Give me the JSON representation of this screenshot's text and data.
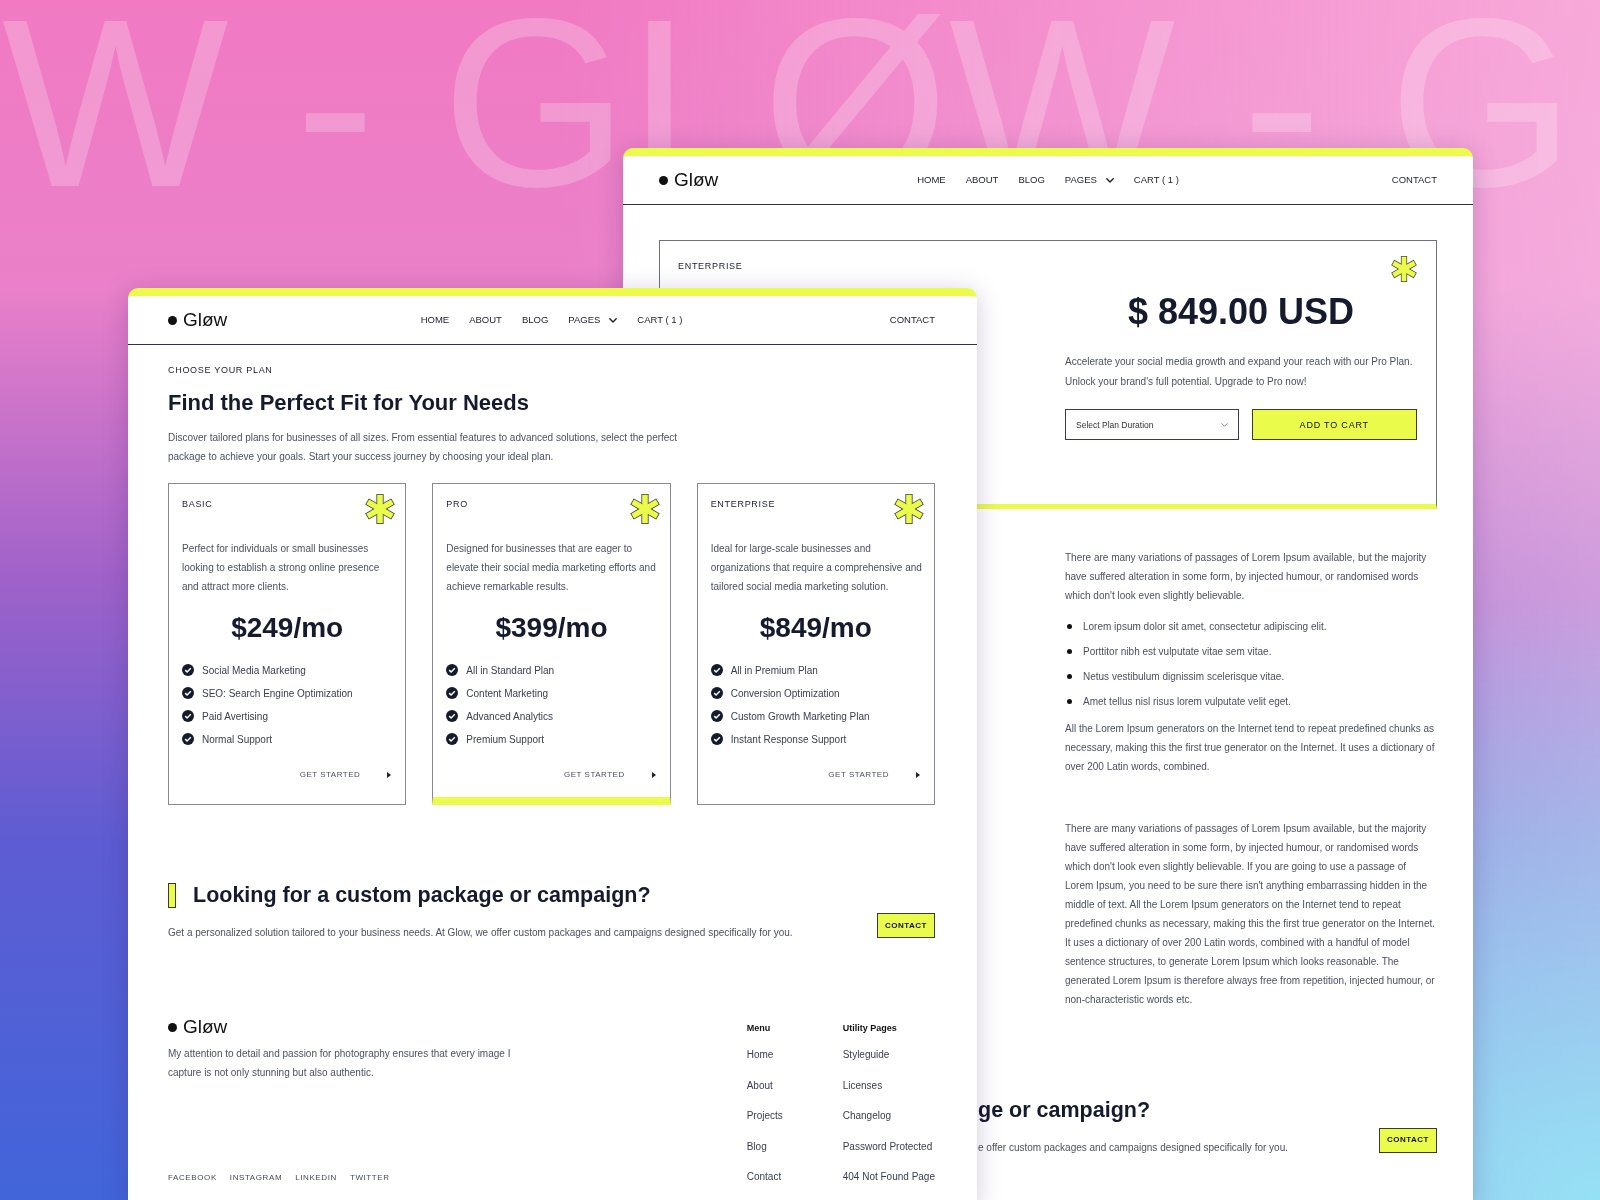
{
  "background": {
    "lettering": "W - GLØW - G"
  },
  "back_window": {
    "header": {
      "logo": "Gløw",
      "nav": [
        {
          "label": "HOME",
          "kind": "link"
        },
        {
          "label": "ABOUT",
          "kind": "link"
        },
        {
          "label": "BLOG",
          "kind": "link"
        },
        {
          "label": "PAGES",
          "kind": "dropdown"
        },
        {
          "label": "CART ( 1 )",
          "kind": "link"
        }
      ],
      "contact": "CONTACT"
    },
    "product": {
      "tier": "ENTERPRISE",
      "price": "$ 849.00 USD",
      "description": "Accelerate your social media growth and expand your reach with our Pro Plan. Unlock your brand's full potential. Upgrade to Pro now!",
      "duration_select": {
        "placeholder": "Select Plan Duration"
      },
      "add_to_cart": "ADD TO CART"
    },
    "article": [
      {
        "kind": "paragraph",
        "text": "There are many variations of passages of Lorem Ipsum available, but the majority have suffered alteration in some form, by injected humour, or randomised words which don't look even slightly believable."
      },
      {
        "kind": "list",
        "items": [
          "Lorem ipsum dolor sit amet, consectetur adipiscing elit.",
          "Porttitor nibh est vulputate vitae sem vitae.",
          "Netus vestibulum dignissim scelerisque vitae.",
          "Amet tellus nisl risus lorem vulputate velit eget."
        ]
      },
      {
        "kind": "paragraph",
        "text": "All the Lorem Ipsum generators on the Internet tend to repeat predefined chunks as necessary, making this the first true generator on the Internet. It uses a dictionary of over 200 Latin words, combined."
      },
      {
        "kind": "paragraph",
        "text": "There are many variations of passages of Lorem Ipsum available, but the majority have suffered alteration in some form, by injected humour, or randomised words which don't look even slightly believable. If you are going to use a passage of Lorem Ipsum, you need to be sure there isn't anything embarrassing hidden in the middle of text. All the Lorem Ipsum generators on the Internet tend to repeat predefined chunks as necessary, making this the first true generator on the Internet. It uses a dictionary of over 200 Latin words, combined with a handful of model sentence structures, to generate Lorem Ipsum which looks reasonable. The generated Lorem Ipsum is therefore always free from repetition, injected humour, or non-characteristic words etc."
      }
    ],
    "cta": {
      "heading": "ge or campaign?",
      "text": "e offer custom packages and campaigns designed specifically for you.",
      "button": "CONTACT"
    }
  },
  "front_window": {
    "header": {
      "logo": "Gløw",
      "nav": [
        {
          "label": "HOME",
          "kind": "link"
        },
        {
          "label": "ABOUT",
          "kind": "link"
        },
        {
          "label": "BLOG",
          "kind": "link"
        },
        {
          "label": "PAGES",
          "kind": "dropdown"
        },
        {
          "label": "CART ( 1 )",
          "kind": "link"
        }
      ],
      "contact": "CONTACT"
    },
    "plans": {
      "eyebrow": "CHOOSE YOUR PLAN",
      "heading": "Find the Perfect Fit for Your Needs",
      "intro": "Discover tailored plans for businesses of all sizes. From essential features to advanced solutions, select the perfect package to achieve your goals. Start your success journey by choosing your ideal plan.",
      "cards": [
        {
          "name": "BASIC",
          "description": "Perfect for individuals or small businesses looking to establish a strong online presence and attract more clients.",
          "price": "$249/mo",
          "features": [
            "Social Media Marketing",
            "SEO: Search Engine Optimization",
            "Paid Avertising",
            "Normal Support"
          ],
          "cta": "GET STARTED",
          "selected": false
        },
        {
          "name": "PRO",
          "description": "Designed for businesses that are eager to elevate their social media marketing efforts and achieve remarkable results.",
          "price": "$399/mo",
          "features": [
            "All in Standard Plan",
            "Content Marketing",
            "Advanced Analytics",
            "Premium Support"
          ],
          "cta": "GET STARTED",
          "selected": true
        },
        {
          "name": "ENTERPRISE",
          "description": "Ideal for large-scale businesses and organizations that require a comprehensive and tailored social media marketing solution.",
          "price": "$849/mo",
          "features": [
            "All in Premium Plan",
            "Conversion Optimization",
            "Custom Growth Marketing Plan",
            "Instant Response Support"
          ],
          "cta": "GET STARTED",
          "selected": false
        }
      ]
    },
    "cta": {
      "heading": "Looking for a custom package or campaign?",
      "text": "Get a personalized solution tailored to your business needs. At Glow, we offer custom packages and campaigns designed specifically for you.",
      "button": "CONTACT"
    },
    "footer": {
      "logo": "Gløw",
      "tagline": "My attention to detail and passion for photography ensures that every image I capture is not only stunning but also authentic.",
      "columns": [
        {
          "title": "Menu",
          "links": [
            "Home",
            "About",
            "Projects",
            "Blog",
            "Contact"
          ]
        },
        {
          "title": "Utility Pages",
          "links": [
            "Styleguide",
            "Licenses",
            "Changelog",
            "Password Protected",
            "404 Not Found Page"
          ]
        }
      ],
      "social": [
        "FACEBOOK",
        "INSTAGRAM",
        "LINKEDIN",
        "TWITTER"
      ]
    }
  }
}
